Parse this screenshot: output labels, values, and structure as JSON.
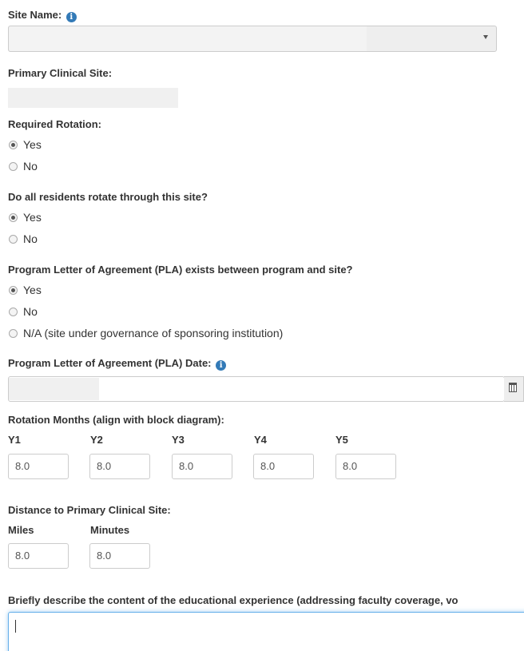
{
  "site_name": {
    "label": "Site Name:",
    "info_icon": "info-circle-icon",
    "dropdown_icon": "caret-down-icon"
  },
  "primary_clinical_site": {
    "label": "Primary Clinical Site:"
  },
  "required_rotation": {
    "label": "Required Rotation:",
    "options": [
      "Yes",
      "No"
    ],
    "selected": "Yes"
  },
  "all_residents": {
    "label": "Do all residents rotate through this site?",
    "options": [
      "Yes",
      "No"
    ],
    "selected": "Yes"
  },
  "pla_exists": {
    "label": "Program Letter of Agreement (PLA) exists between program and site?",
    "options": [
      "Yes",
      "No",
      "N/A (site under governance of sponsoring institution)"
    ],
    "selected": "Yes"
  },
  "pla_date": {
    "label": "Program Letter of Agreement (PLA) Date:",
    "info_icon": "info-circle-icon",
    "calendar_icon": "calendar-icon"
  },
  "rotation_months": {
    "label": "Rotation Months (align with block diagram):",
    "columns": [
      {
        "label": "Y1",
        "value": "8.0"
      },
      {
        "label": "Y2",
        "value": "8.0"
      },
      {
        "label": "Y3",
        "value": "8.0"
      },
      {
        "label": "Y4",
        "value": "8.0"
      },
      {
        "label": "Y5",
        "value": "8.0"
      }
    ]
  },
  "distance": {
    "label": "Distance to Primary Clinical Site:",
    "miles_label": "Miles",
    "miles_value": "8.0",
    "minutes_label": "Minutes",
    "minutes_value": "8.0"
  },
  "description": {
    "label": "Briefly describe the content of the educational experience (addressing faculty coverage, vo"
  }
}
